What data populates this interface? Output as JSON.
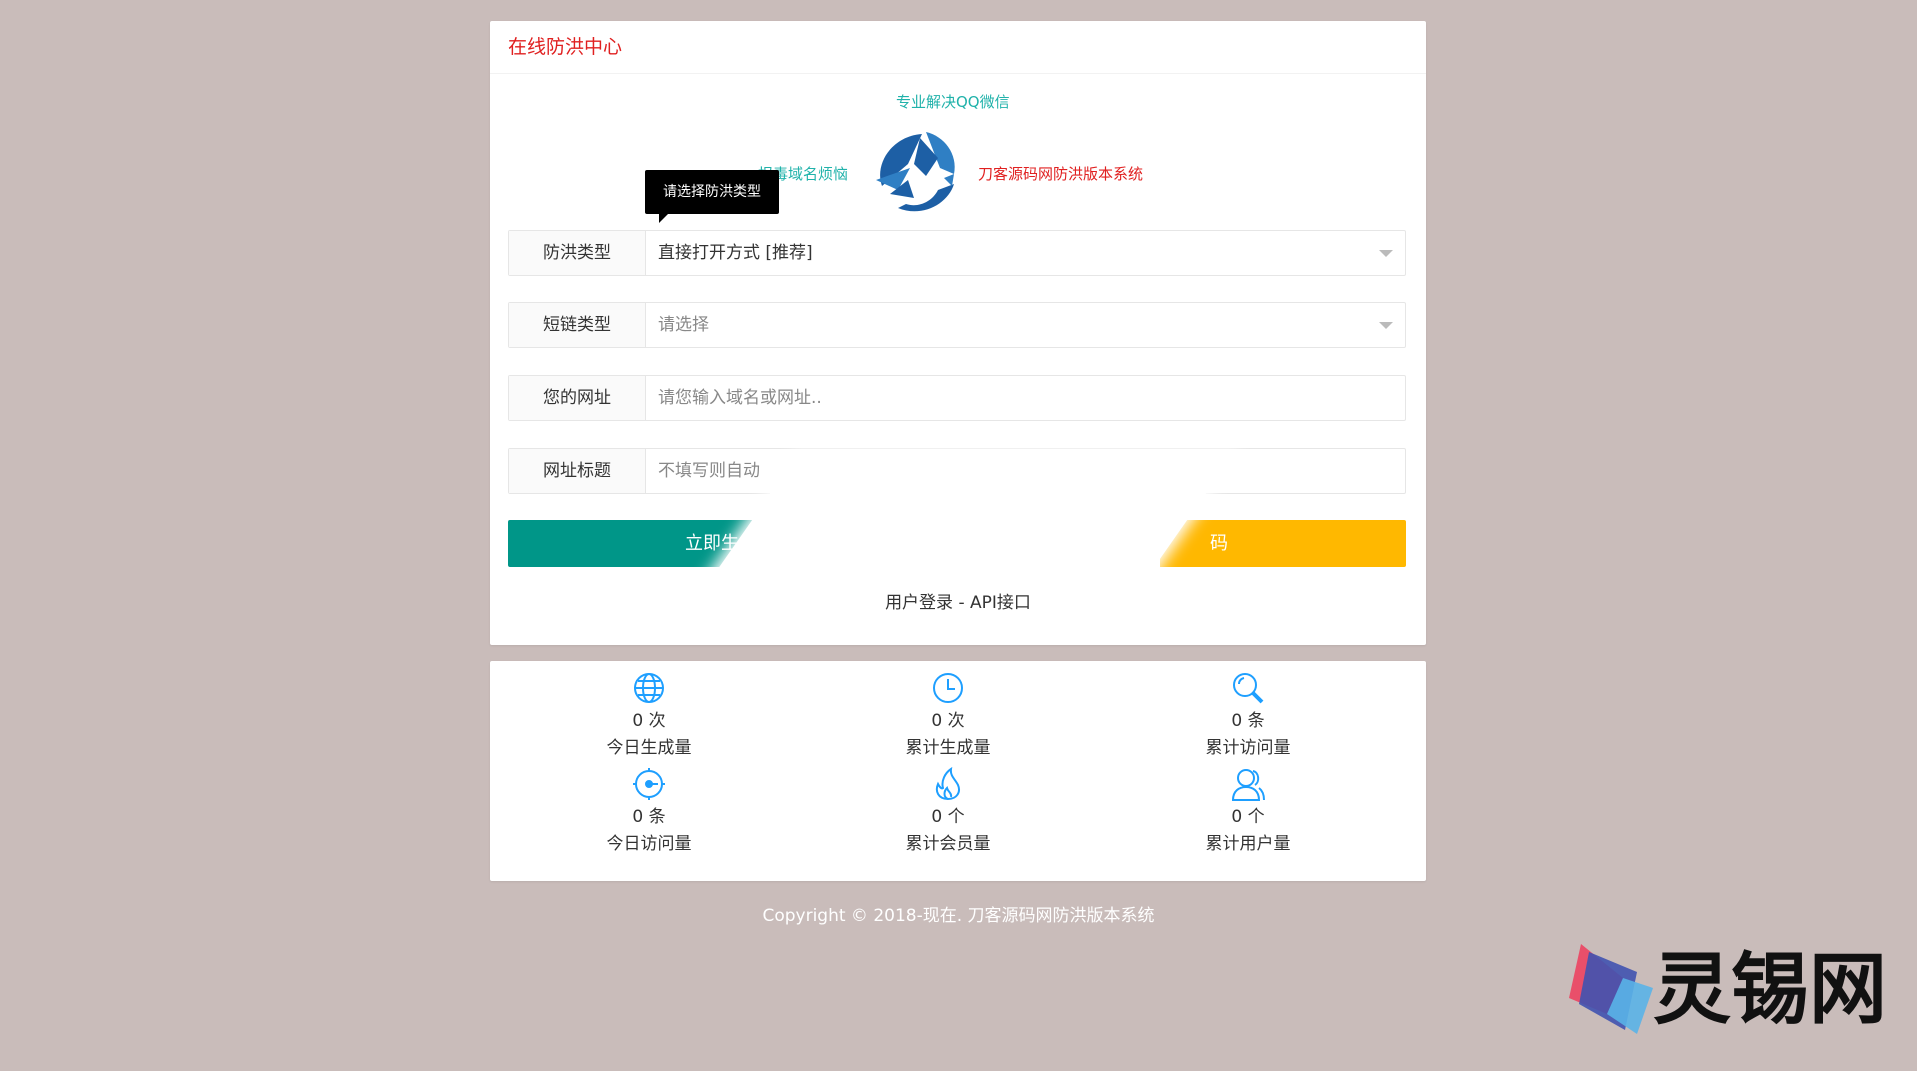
{
  "header": {
    "title": "在线防洪中心"
  },
  "slogans": {
    "top": "专业解决QQ微信",
    "left": "报毒域名烦恼",
    "right": "刀客源码网防洪版本系统"
  },
  "tooltip": {
    "text": "请选择防洪类型"
  },
  "form": {
    "type": {
      "label": "防洪类型",
      "value": "直接打开方式 [推荐]"
    },
    "short": {
      "label": "短链类型",
      "placeholder": "请选择"
    },
    "url": {
      "label": "您的网址",
      "placeholder": "请您输入域名或网址.."
    },
    "title": {
      "label": "网址标题",
      "placeholder": "不填写则自动"
    }
  },
  "buttons": {
    "generate": "立即生成",
    "second_partial": "码"
  },
  "links": {
    "login": "用户登录",
    "separator": " - ",
    "api": "API接口"
  },
  "stats": [
    {
      "icon": "globe-icon",
      "value": "0 次",
      "label": "今日生成量"
    },
    {
      "icon": "clock-icon",
      "value": "0 次",
      "label": "累计生成量"
    },
    {
      "icon": "search-icon",
      "value": "0 条",
      "label": "累计访问量"
    },
    {
      "icon": "dial-icon",
      "value": "0 条",
      "label": "今日访问量"
    },
    {
      "icon": "flame-icon",
      "value": "0 个",
      "label": "累计会员量"
    },
    {
      "icon": "users-icon",
      "value": "0 个",
      "label": "累计用户量"
    }
  ],
  "footer": {
    "copyright": "Copyright © 2018-现在. 刀客源码网防洪版本系统"
  },
  "watermark": {
    "text": "灵锡网"
  },
  "colors": {
    "background": "#c9bcba",
    "title": "#e02020",
    "teal": "#20b2aa",
    "primary": "#009688",
    "warm": "#ffb800",
    "icon": "#1e9fff"
  }
}
